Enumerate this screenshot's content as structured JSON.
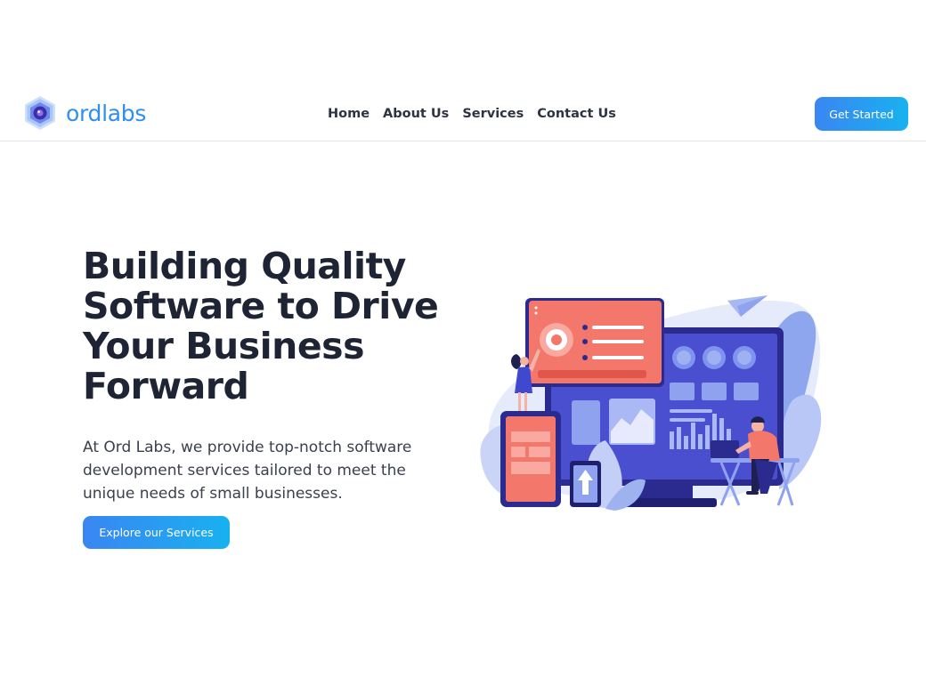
{
  "brand": {
    "name": "ordlabs"
  },
  "nav": {
    "items": [
      {
        "label": "Home"
      },
      {
        "label": "About Us"
      },
      {
        "label": "Services"
      },
      {
        "label": "Contact Us"
      }
    ],
    "cta_label": "Get Started"
  },
  "hero": {
    "title_lines": [
      "Building Quality",
      "Software to Drive",
      "Your Business",
      "Forward"
    ],
    "description_lines": [
      "At Ord Labs, we provide top-notch software",
      "development services tailored to meet the",
      "unique needs of small businesses."
    ],
    "button_label": "Explore our Services",
    "illustration_icon": "software-dashboard-illustration"
  },
  "colors": {
    "brand": "#2f8ff0",
    "button_start": "#3a86f2",
    "button_end": "#18b1f0",
    "heading": "#1e2433",
    "accent_coral": "#f26b5b",
    "accent_indigo": "#3b3aa8"
  }
}
